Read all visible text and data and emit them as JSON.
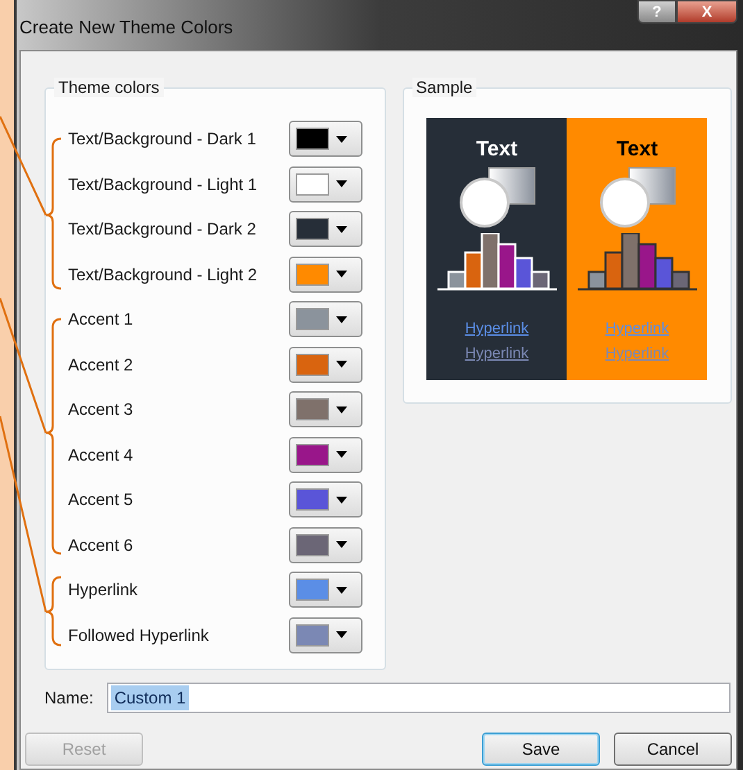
{
  "window": {
    "title": "Create New Theme Colors",
    "help_button": "?",
    "close_button": "X"
  },
  "theme_colors": {
    "title": "Theme colors",
    "rows": [
      {
        "label": "Text/Background - Dark 1",
        "color": "#000000"
      },
      {
        "label": "Text/Background - Light 1",
        "color": "#ffffff"
      },
      {
        "label": "Text/Background - Dark 2",
        "color": "#262e38"
      },
      {
        "label": "Text/Background - Light 2",
        "color": "#ff8a00"
      },
      {
        "label": "Accent 1",
        "color": "#8b939c"
      },
      {
        "label": "Accent 2",
        "color": "#d9640f"
      },
      {
        "label": "Accent 3",
        "color": "#7f716b"
      },
      {
        "label": "Accent 4",
        "color": "#99168a"
      },
      {
        "label": "Accent 5",
        "color": "#5a55d8"
      },
      {
        "label": "Accent 6",
        "color": "#6b6676"
      },
      {
        "label": "Hyperlink",
        "color": "#5b8ee6"
      },
      {
        "label": "Followed Hyperlink",
        "color": "#7b88b4"
      }
    ]
  },
  "sample": {
    "title": "Sample",
    "panels": [
      {
        "kind": "dark",
        "heading": "Text",
        "links": [
          "Hyperlink",
          "Hyperlink"
        ]
      },
      {
        "kind": "light",
        "heading": "Text",
        "links": [
          "Hyperlink",
          "Hyperlink"
        ]
      }
    ]
  },
  "name_field": {
    "label": "Name:",
    "value": "Custom 1"
  },
  "buttons": [
    {
      "label": "Reset",
      "disabled": true,
      "default": false
    },
    {
      "label": "Save",
      "disabled": false,
      "default": true
    },
    {
      "label": "Cancel",
      "disabled": false,
      "default": false
    }
  ]
}
